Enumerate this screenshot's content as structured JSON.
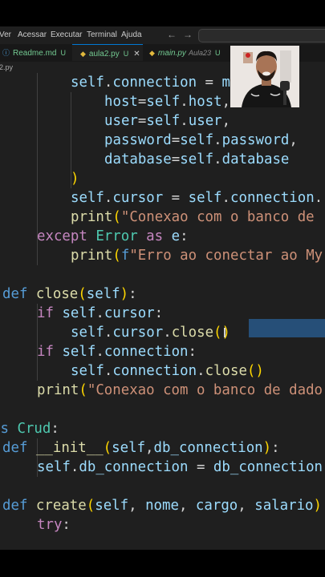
{
  "menubar": {
    "items": [
      "Ver",
      "Acessar",
      "Executar",
      "Terminal",
      "Ajuda"
    ],
    "back_glyph": "←",
    "forward_glyph": "→"
  },
  "tabs": [
    {
      "icon": "info-icon",
      "icon_glyph": "ⓘ",
      "name": "Readme.md",
      "status": "U",
      "active": false
    },
    {
      "icon": "python-icon",
      "icon_glyph": "◆",
      "name": "aula2.py",
      "status": "U",
      "close": "✕",
      "active": true
    },
    {
      "icon": "python-icon",
      "icon_glyph": "◆",
      "name": "main.py",
      "folder": "Aula23",
      "status": "U",
      "active": false
    }
  ],
  "breadcrumb": "2.py",
  "code_lines": [
    [
      [
        "v",
        "self"
      ],
      [
        "o",
        "."
      ],
      [
        "v",
        "connection"
      ],
      [
        "o",
        " = "
      ],
      [
        "v",
        "m"
      ]
    ],
    [
      [
        "v",
        "host"
      ],
      [
        "o",
        "="
      ],
      [
        "v",
        "self"
      ],
      [
        "o",
        "."
      ],
      [
        "v",
        "host"
      ],
      [
        "o",
        ","
      ]
    ],
    [
      [
        "v",
        "user"
      ],
      [
        "o",
        "="
      ],
      [
        "v",
        "self"
      ],
      [
        "o",
        "."
      ],
      [
        "v",
        "user"
      ],
      [
        "o",
        ","
      ]
    ],
    [
      [
        "v",
        "password"
      ],
      [
        "o",
        "="
      ],
      [
        "v",
        "self"
      ],
      [
        "o",
        "."
      ],
      [
        "v",
        "password"
      ],
      [
        "o",
        ","
      ]
    ],
    [
      [
        "v",
        "database"
      ],
      [
        "o",
        "="
      ],
      [
        "v",
        "self"
      ],
      [
        "o",
        "."
      ],
      [
        "v",
        "database"
      ]
    ],
    [
      [
        "p",
        ")"
      ]
    ],
    [
      [
        "v",
        "self"
      ],
      [
        "o",
        "."
      ],
      [
        "v",
        "cursor"
      ],
      [
        "o",
        " = "
      ],
      [
        "v",
        "self"
      ],
      [
        "o",
        "."
      ],
      [
        "v",
        "connection"
      ],
      [
        "o",
        "."
      ]
    ],
    [
      [
        "f",
        "print"
      ],
      [
        "p",
        "("
      ],
      [
        "s",
        "\"Conexao com o banco de "
      ]
    ],
    [
      [
        "c",
        "except"
      ],
      [
        "o",
        " "
      ],
      [
        "t",
        "Error"
      ],
      [
        "o",
        " "
      ],
      [
        "c",
        "as"
      ],
      [
        "o",
        " "
      ],
      [
        "v",
        "e"
      ],
      [
        "o",
        ":"
      ]
    ],
    [
      [
        "f",
        "print"
      ],
      [
        "p",
        "("
      ],
      [
        "k",
        "f"
      ],
      [
        "s",
        "\"Erro ao conectar ao My"
      ]
    ],
    [],
    [
      [
        "k",
        "def"
      ],
      [
        "o",
        " "
      ],
      [
        "f",
        "close"
      ],
      [
        "p",
        "("
      ],
      [
        "v",
        "self"
      ],
      [
        "p",
        ")"
      ],
      [
        "o",
        ":"
      ]
    ],
    [
      [
        "c",
        "if"
      ],
      [
        "o",
        " "
      ],
      [
        "v",
        "self"
      ],
      [
        "o",
        "."
      ],
      [
        "v",
        "cursor"
      ],
      [
        "o",
        ":"
      ]
    ],
    [
      [
        "v",
        "self"
      ],
      [
        "o",
        "."
      ],
      [
        "v",
        "cursor"
      ],
      [
        "o",
        "."
      ],
      [
        "f",
        "close"
      ],
      [
        "p",
        "()"
      ]
    ],
    [
      [
        "c",
        "if"
      ],
      [
        "o",
        " "
      ],
      [
        "v",
        "self"
      ],
      [
        "o",
        "."
      ],
      [
        "v",
        "connection"
      ],
      [
        "o",
        ":"
      ]
    ],
    [
      [
        "v",
        "self"
      ],
      [
        "o",
        "."
      ],
      [
        "v",
        "connection"
      ],
      [
        "o",
        "."
      ],
      [
        "f",
        "close"
      ],
      [
        "p",
        "()"
      ]
    ],
    [
      [
        "f",
        "print"
      ],
      [
        "p",
        "("
      ],
      [
        "s",
        "\"Conexao com o banco de dado"
      ]
    ],
    [],
    [
      [
        "k",
        "ss"
      ],
      [
        "o",
        " "
      ],
      [
        "t",
        "Crud"
      ],
      [
        "o",
        ":"
      ]
    ],
    [
      [
        "k",
        "def"
      ],
      [
        "o",
        " "
      ],
      [
        "f",
        "__init__"
      ],
      [
        "p",
        "("
      ],
      [
        "v",
        "self"
      ],
      [
        "o",
        ","
      ],
      [
        "v",
        "db_connection"
      ],
      [
        "p",
        ")"
      ],
      [
        "o",
        ":"
      ]
    ],
    [
      [
        "v",
        "self"
      ],
      [
        "o",
        "."
      ],
      [
        "v",
        "db_connection"
      ],
      [
        "o",
        " = "
      ],
      [
        "v",
        "db_connection"
      ]
    ],
    [],
    [
      [
        "k",
        "def"
      ],
      [
        "o",
        " "
      ],
      [
        "f",
        "create"
      ],
      [
        "p",
        "("
      ],
      [
        "v",
        "self"
      ],
      [
        "o",
        ", "
      ],
      [
        "v",
        "nome"
      ],
      [
        "o",
        ", "
      ],
      [
        "v",
        "cargo"
      ],
      [
        "o",
        ", "
      ],
      [
        "v",
        "salario"
      ],
      [
        "p",
        ")"
      ]
    ],
    [
      [
        "c",
        "try"
      ],
      [
        "o",
        ":"
      ]
    ]
  ],
  "webcam": {
    "label": "presenter-webcam"
  }
}
